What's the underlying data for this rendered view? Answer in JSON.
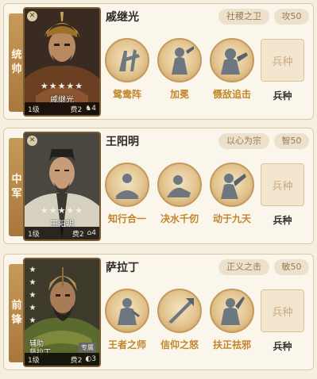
{
  "cards": [
    {
      "role": [
        "统",
        "帅"
      ],
      "hero_name": "戚继光",
      "portrait_name": "戚继光",
      "stars": "★★★★★",
      "level": "1级",
      "cost": "费2",
      "unit_count": "4",
      "trait_tag": "社稷之卫",
      "stat_tag": "攻50",
      "skills": [
        "鸳鸯阵",
        "加冕",
        "慑敌追击"
      ],
      "troop_button": "兵种",
      "troop_label": "兵种"
    },
    {
      "role": [
        "中",
        "军"
      ],
      "hero_name": "王阳明",
      "portrait_name": "王阳明",
      "stars": "★★★★★",
      "level": "1级",
      "cost": "费2",
      "unit_count": "4",
      "trait_tag": "以心为宗",
      "stat_tag": "智50",
      "skills": [
        "知行合一",
        "决水千仞",
        "动于九天"
      ],
      "troop_button": "兵种",
      "troop_label": "兵种"
    },
    {
      "role": [
        "前",
        "锋"
      ],
      "hero_name": "萨拉丁",
      "portrait_subtitle": "辅助",
      "portrait_name": "萨拉丁",
      "portrait_tag": "专属",
      "stars": "★★★★★",
      "level": "1级",
      "cost": "费2",
      "unit_count": "3",
      "trait_tag": "正义之击",
      "stat_tag": "敏50",
      "skills": [
        "王者之师",
        "信仰之怒",
        "扶正祛邪"
      ],
      "troop_button": "兵种",
      "troop_label": "兵种"
    }
  ]
}
